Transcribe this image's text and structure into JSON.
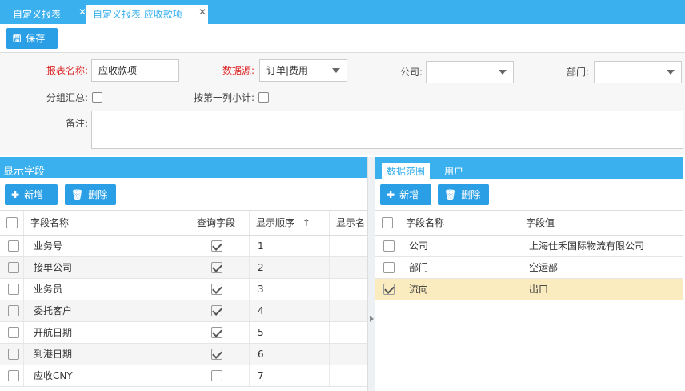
{
  "tabs": [
    {
      "label": "自定义报表",
      "active": false
    },
    {
      "label": "自定义报表 应收款项",
      "active": true
    }
  ],
  "toolbar": {
    "save_label": "保存"
  },
  "form": {
    "report_name_label": "报表名称:",
    "report_name_value": "应收款项",
    "datasource_label": "数据源:",
    "datasource_value": "订单|费用",
    "company_label": "公司:",
    "company_value": "",
    "dept_label": "部门:",
    "dept_value": "",
    "group_total_label": "分组汇总:",
    "col_subtotal_label": "按第一列小计:",
    "remark_label": "备注:",
    "remark_value": ""
  },
  "left_panel": {
    "title": "显示字段",
    "add_label": "新增",
    "delete_label": "删除",
    "columns": [
      "字段名称",
      "查询字段",
      "显示顺序",
      "显示名"
    ],
    "sort_indicator": "↑",
    "rows": [
      {
        "name": "业务号",
        "query": true,
        "order": "1"
      },
      {
        "name": "接单公司",
        "query": true,
        "order": "2"
      },
      {
        "name": "业务员",
        "query": true,
        "order": "3"
      },
      {
        "name": "委托客户",
        "query": true,
        "order": "4"
      },
      {
        "name": "开航日期",
        "query": true,
        "order": "5"
      },
      {
        "name": "到港日期",
        "query": true,
        "order": "6"
      },
      {
        "name": "应收CNY",
        "query": false,
        "order": "7"
      }
    ]
  },
  "right_panel": {
    "tabs": [
      "数据范围",
      "用户"
    ],
    "add_label": "新增",
    "delete_label": "删除",
    "columns": [
      "字段名称",
      "字段值"
    ],
    "rows": [
      {
        "name": "公司",
        "value": "上海仕禾国际物流有限公司",
        "checked": false
      },
      {
        "name": "部门",
        "value": "空运部",
        "checked": false
      },
      {
        "name": "流向",
        "value": "出口",
        "checked": true
      }
    ]
  },
  "colors": {
    "accent": "#3ab0ee",
    "button": "#2b9fe6",
    "required": "#d22222",
    "selected_row": "#fbecc0"
  }
}
